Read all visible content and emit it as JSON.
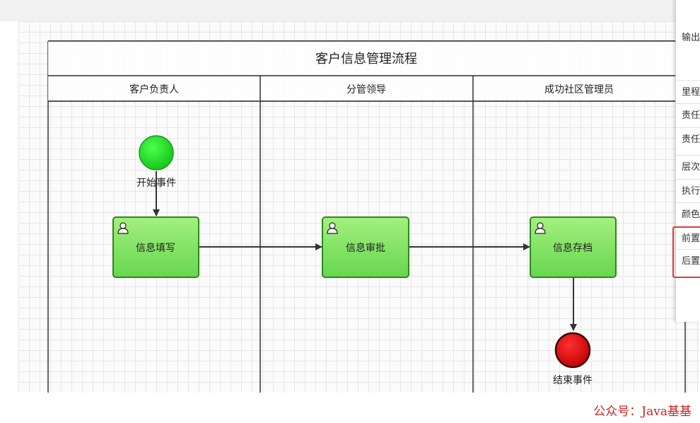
{
  "diagram": {
    "title": "客户信息管理流程",
    "lanes": [
      {
        "label": "客户负责人"
      },
      {
        "label": "分管领导"
      },
      {
        "label": "成功社区管理员"
      }
    ],
    "start_event": {
      "label": "开始事件",
      "color": "#19d11f"
    },
    "end_event": {
      "label": "结束事件",
      "color": "#d10000"
    },
    "tasks": [
      {
        "label": "信息填写"
      },
      {
        "label": "信息审批"
      },
      {
        "label": "信息存档"
      }
    ],
    "task_fill_top": "#a3f07f",
    "task_fill_bottom": "#67d64f",
    "task_border": "#2a8a19"
  },
  "side_panel": {
    "output_label": "输出",
    "items": [
      "里程",
      "责任",
      "责任",
      "层次",
      "执行",
      "颜色",
      "前置",
      "后置"
    ],
    "highlight_color": "#e23b3b"
  },
  "watermark": "公众号：Java基基"
}
